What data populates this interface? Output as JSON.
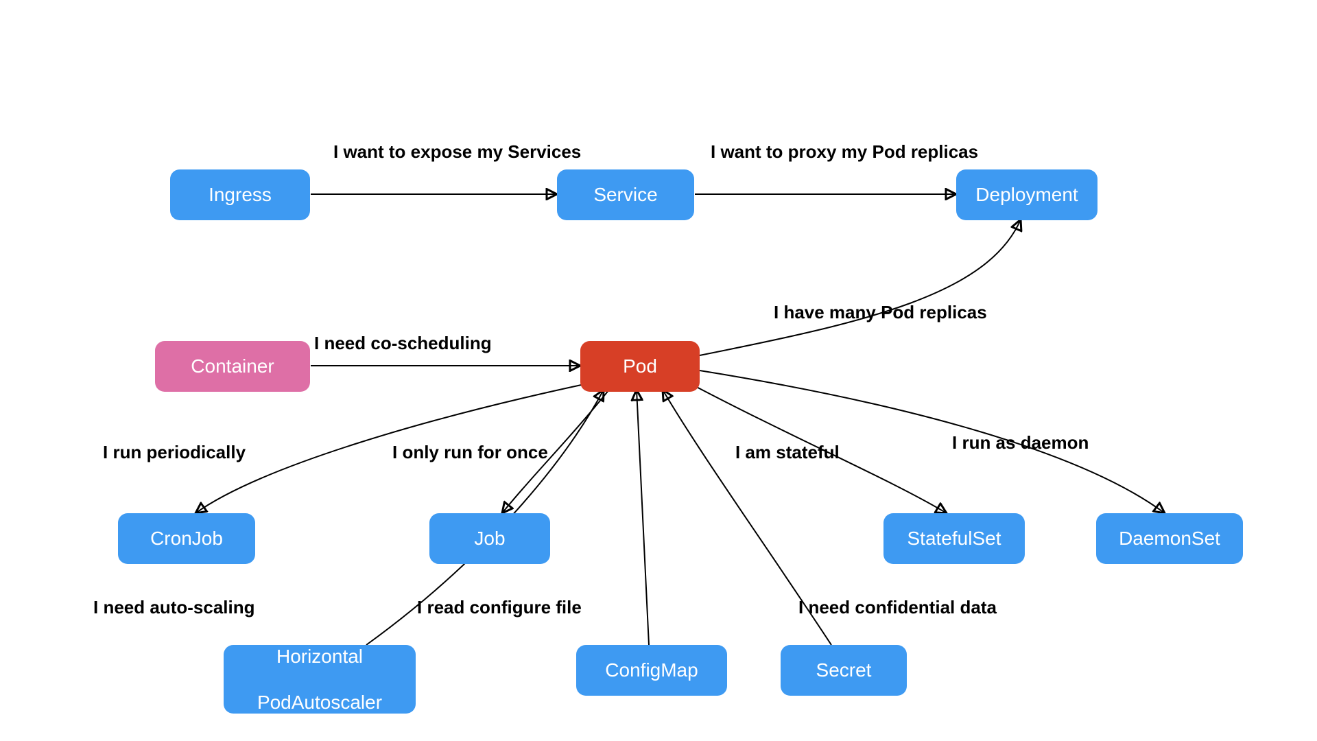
{
  "nodes": {
    "ingress": "Ingress",
    "service": "Service",
    "deployment": "Deployment",
    "container": "Container",
    "pod": "Pod",
    "cronjob": "CronJob",
    "job": "Job",
    "statefulset": "StatefulSet",
    "daemonset": "DaemonSet",
    "hpa_line1": "Horizontal",
    "hpa_line2": "PodAutoscaler",
    "configmap": "ConfigMap",
    "secret": "Secret"
  },
  "edges": {
    "ingress_to_service": "I want to expose my Services",
    "service_to_deployment": "I want to proxy my Pod replicas",
    "container_to_pod": "I need co-scheduling",
    "pod_to_deployment": "I have many Pod replicas",
    "pod_to_cronjob": "I run periodically",
    "pod_to_job": "I only run for once",
    "pod_to_statefulset": "I am stateful",
    "pod_to_daemonset": "I run as daemon",
    "hpa_to_pod": "I need auto-scaling",
    "configmap_to_pod": "I read configure file",
    "secret_to_pod": "I need confidential data"
  },
  "colors": {
    "blue": "#3e9af2",
    "pink": "#de6fa6",
    "red": "#d73f26"
  }
}
